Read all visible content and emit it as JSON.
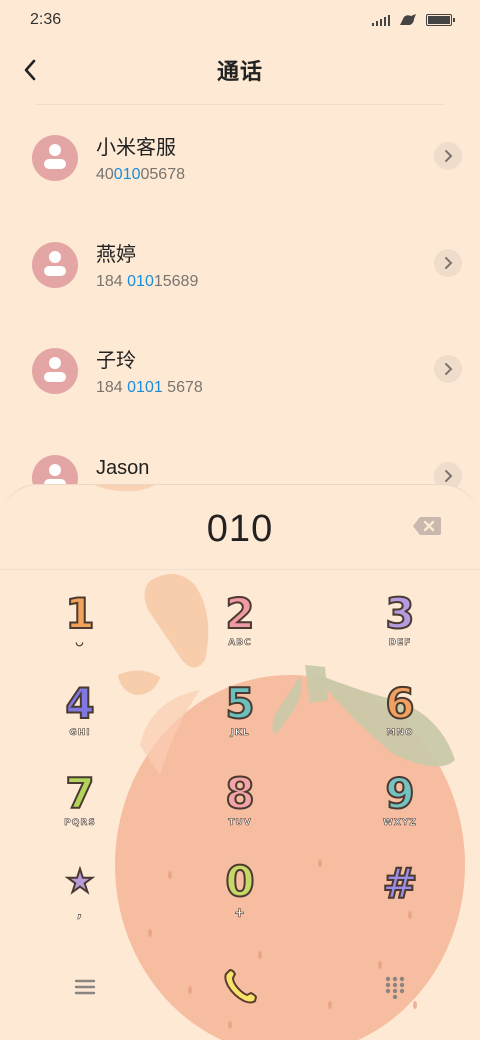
{
  "status_bar": {
    "time": "2:36"
  },
  "header": {
    "title": "通话"
  },
  "contacts": [
    {
      "name": "小米客服",
      "number_pre": "40",
      "number_hl": "010",
      "number_post": "05678"
    },
    {
      "name": "燕婷",
      "number_pre": "184 ",
      "number_hl": "010",
      "number_post": "15689"
    },
    {
      "name": "子玲",
      "number_pre": "184 ",
      "number_hl": "0101",
      "number_post": " 5678"
    },
    {
      "name": "Jason",
      "number_pre": "",
      "number_hl": "",
      "number_post": ""
    }
  ],
  "dialer": {
    "input_value": "010",
    "keys": [
      {
        "digit": "1",
        "letters": "◡",
        "color": "#f2a35a"
      },
      {
        "digit": "2",
        "letters": "ABC",
        "color": "#f09aa6"
      },
      {
        "digit": "3",
        "letters": "DEF",
        "color": "#b59be0"
      },
      {
        "digit": "4",
        "letters": "GHI",
        "color": "#7f78e0"
      },
      {
        "digit": "5",
        "letters": "JKL",
        "color": "#69c0bf"
      },
      {
        "digit": "6",
        "letters": "MNO",
        "color": "#f0a060"
      },
      {
        "digit": "7",
        "letters": "PQRS",
        "color": "#b3d45a"
      },
      {
        "digit": "8",
        "letters": "TUV",
        "color": "#f2a4a8"
      },
      {
        "digit": "9",
        "letters": "WXYZ",
        "color": "#74c2c2"
      },
      {
        "digit": "★",
        "letters": ",",
        "color": "#b89ad8"
      },
      {
        "digit": "0",
        "letters": "+",
        "color": "#c8d868"
      },
      {
        "digit": "#",
        "letters": "",
        "color": "#9a8ee6"
      }
    ]
  },
  "colors": {
    "background": "#fde9d4",
    "highlight": "#1a8ddb",
    "avatar": "#e4a6a5"
  },
  "icons": {
    "menu": "menu-icon",
    "call": "phone-icon",
    "keypad_toggle": "keypad-icon",
    "delete": "backspace-icon",
    "back": "back-arrow-icon",
    "detail": "chevron-right-icon"
  }
}
